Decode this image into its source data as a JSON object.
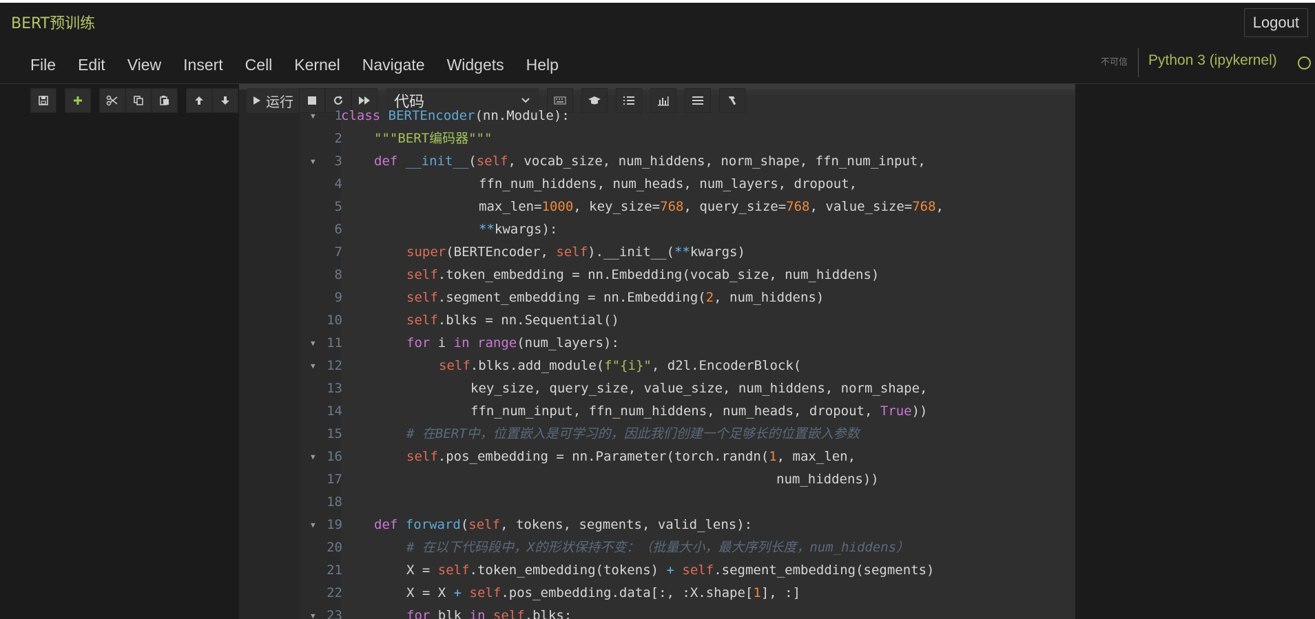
{
  "app": {
    "notebook_title": "BERT预训练",
    "logout_label": "Logout",
    "trust_label": "不可信",
    "kernel_name": "Python 3 (ipykernel)"
  },
  "menu": [
    "File",
    "Edit",
    "View",
    "Insert",
    "Cell",
    "Kernel",
    "Navigate",
    "Widgets",
    "Help"
  ],
  "toolbar": {
    "run_label": "运行",
    "cell_type_value": "代码",
    "icons": [
      "save-icon",
      "add-cell-icon",
      "cut-icon",
      "copy-icon",
      "paste-icon",
      "move-up-icon",
      "move-down-icon",
      "run-icon",
      "stop-icon",
      "restart-icon",
      "fast-forward-icon",
      "keyboard-icon",
      "graduation-cap-icon",
      "numbered-list-icon",
      "bar-chart-icon",
      "list-icon",
      "hammer-icon"
    ]
  },
  "code": {
    "line_numbers": [
      "1",
      "2",
      "3",
      "4",
      "5",
      "6",
      "7",
      "8",
      "9",
      "10",
      "11",
      "12",
      "13",
      "14",
      "15",
      "16",
      "17",
      "18",
      "19",
      "20",
      "21",
      "22",
      "23"
    ],
    "tokens": {
      "l1": [
        "class ",
        "BERTEncoder",
        "(nn.Module):"
      ],
      "l2": [
        "\"\"\"BERT编码器\"\"\""
      ],
      "l3": [
        "def ",
        "__init__",
        "(",
        "self",
        ", vocab_size, num_hiddens, norm_shape, ffn_num_input,"
      ],
      "l4": [
        "ffn_num_hiddens, num_heads, num_layers, dropout,"
      ],
      "l5": [
        "max_len=",
        "1000",
        ", key_size=",
        "768",
        ", query_size=",
        "768",
        ", value_size=",
        "768",
        ","
      ],
      "l6": [
        "**",
        "kwargs):"
      ],
      "l7": [
        "super",
        "(BERTEncoder, ",
        "self",
        ").__init__(",
        "**",
        "kwargs)"
      ],
      "l8": [
        "self",
        ".token_embedding = nn.Embedding(vocab_size, num_hiddens)"
      ],
      "l9": [
        "self",
        ".segment_embedding = nn.Embedding(",
        "2",
        ", num_hiddens)"
      ],
      "l10": [
        "self",
        ".blks = nn.Sequential()"
      ],
      "l11": [
        "for",
        " i ",
        "in",
        " ",
        "range",
        "(num_layers):"
      ],
      "l12": [
        "self",
        ".blks.add_module(",
        "f\"{i}\"",
        ", d2l.EncoderBlock("
      ],
      "l13": [
        "key_size, query_size, value_size, num_hiddens, norm_shape,"
      ],
      "l14": [
        "ffn_num_input, ffn_num_hiddens, num_heads, dropout, ",
        "True",
        "))"
      ],
      "l15": [
        "# 在BERT中，位置嵌入是可学习的，因此我们创建一个足够长的位置嵌入参数"
      ],
      "l16": [
        "self",
        ".pos_embedding = nn.Parameter(torch.randn(",
        "1",
        ", max_len,"
      ],
      "l17": [
        "num_hiddens))"
      ],
      "l18": [
        ""
      ],
      "l19": [
        "def ",
        "forward",
        "(",
        "self",
        ", tokens, segments, valid_lens):"
      ],
      "l20": [
        "# 在以下代码段中，X的形状保持不变：（批量大小，最大序列长度，num_hiddens）"
      ],
      "l21": [
        "X = ",
        "self",
        ".token_embedding(tokens) ",
        "+",
        " ",
        "self",
        ".segment_embedding(segments)"
      ],
      "l22": [
        "X = X ",
        "+",
        " ",
        "self",
        ".pos_embedding.data[:, :X.shape[",
        "1",
        "], :]"
      ],
      "l23": [
        "for",
        " blk ",
        "in",
        " ",
        "self",
        ".blks:"
      ]
    }
  },
  "colors": {
    "title_accent": "#b6c66a",
    "keyword": "#cc77d6",
    "self": "#e06c58",
    "function": "#5fa8d3",
    "number": "#f08a3c",
    "string": "#a5c25c",
    "comment": "#5a6a7d"
  }
}
